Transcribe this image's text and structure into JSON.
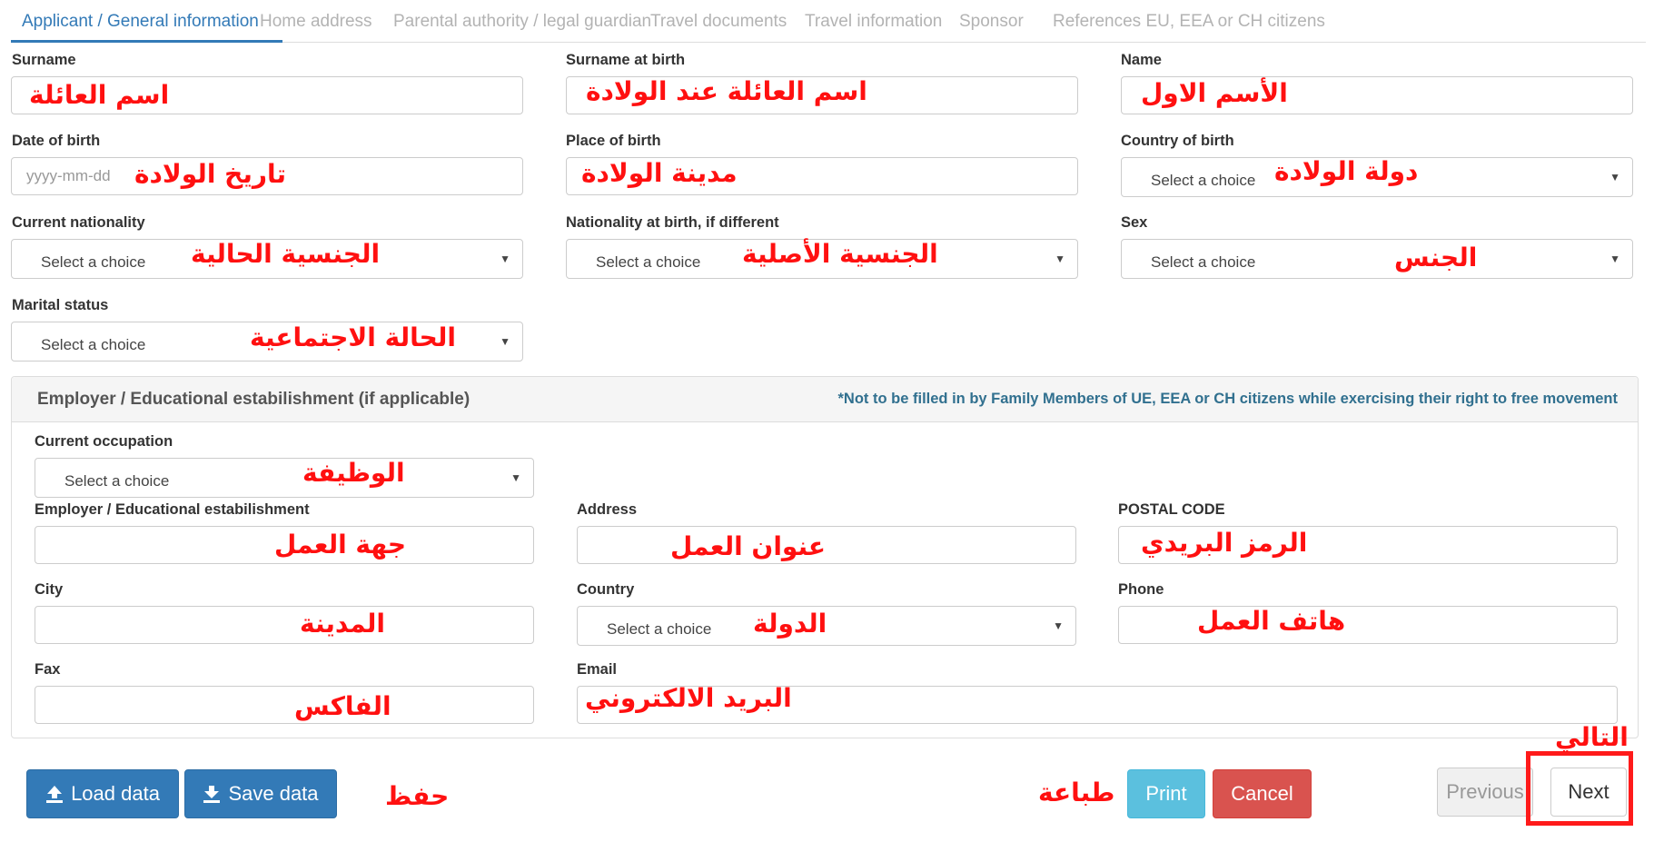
{
  "tabs": [
    {
      "label": "Applicant / General information",
      "active": true
    },
    {
      "label": "Home address"
    },
    {
      "label": "Parental authority / legal guardian"
    },
    {
      "label": "Travel documents"
    },
    {
      "label": "Travel information"
    },
    {
      "label": "Sponsor"
    },
    {
      "label": "References EU, EEA or CH citizens"
    }
  ],
  "applicant": {
    "surname": {
      "label": "Surname",
      "annotation": "اسم العائلة"
    },
    "surname_at_birth": {
      "label": "Surname at birth",
      "annotation": "اسم العائلة عند الولادة"
    },
    "name": {
      "label": "Name",
      "annotation": "الأسم الاول"
    },
    "date_of_birth": {
      "label": "Date of birth",
      "placeholder": "yyyy-mm-dd",
      "annotation": "تاريخ الولادة"
    },
    "place_of_birth": {
      "label": "Place of birth",
      "annotation": "مدينة الولادة"
    },
    "country_of_birth": {
      "label": "Country of birth",
      "value": "Select a choice",
      "annotation": "دولة الولادة"
    },
    "current_nationality": {
      "label": "Current nationality",
      "value": "Select a choice",
      "annotation": "الجنسية الحالية"
    },
    "nationality_at_birth": {
      "label": "Nationality at birth, if different",
      "value": "Select a choice",
      "annotation": "الجنسية الأصلية"
    },
    "sex": {
      "label": "Sex",
      "value": "Select a choice",
      "annotation": "الجنس"
    },
    "marital_status": {
      "label": "Marital status",
      "value": "Select a choice",
      "annotation": "الحالة الاجتماعية"
    }
  },
  "employer": {
    "title": "Employer / Educational estabilishment (if applicable)",
    "note": "*Not to be filled in by Family Members of UE, EEA or CH citizens while exercising their right to free movement",
    "current_occupation": {
      "label": "Current occupation",
      "value": "Select a choice",
      "annotation": "الوظيفة"
    },
    "establishment": {
      "label": "Employer / Educational estabilishment",
      "annotation": "جهة العمل"
    },
    "address": {
      "label": "Address",
      "annotation": "عنوان العمل"
    },
    "postal_code": {
      "label": "POSTAL CODE",
      "annotation": "الرمز البريدي"
    },
    "city": {
      "label": "City",
      "annotation": "المدينة"
    },
    "country": {
      "label": "Country",
      "value": "Select a choice",
      "annotation": "الدولة"
    },
    "phone": {
      "label": "Phone",
      "annotation": "هاتف العمل"
    },
    "fax": {
      "label": "Fax",
      "annotation": "الفاكس"
    },
    "email": {
      "label": "Email",
      "annotation": "البريد الالكتروني"
    }
  },
  "buttons": {
    "load": "Load data",
    "save": "Save data",
    "print": "Print",
    "cancel": "Cancel",
    "previous": "Previous",
    "next": "Next"
  },
  "annotations": {
    "save": "حفظ",
    "print": "طباعة",
    "next": "التالي"
  },
  "colors": {
    "accent_blue": "#337ab7",
    "annotation_red": "#ff1010",
    "print_cyan": "#5bc0de",
    "cancel_red": "#d9534f",
    "note_blue": "#31708f"
  },
  "icons": {
    "load": "upload-icon",
    "save": "download-icon",
    "dropdown": "caret-down-icon"
  }
}
